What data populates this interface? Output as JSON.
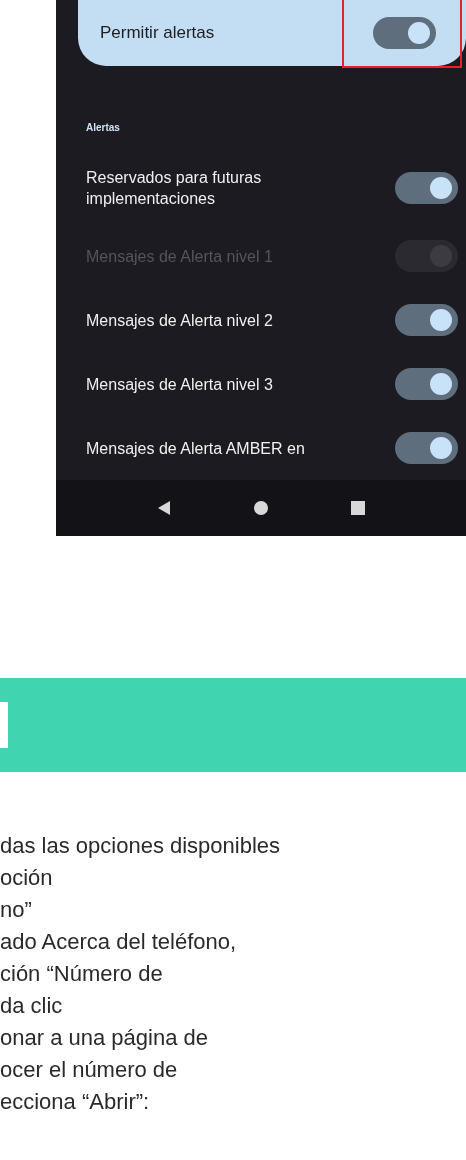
{
  "phone": {
    "master": {
      "label": "Permitir alertas",
      "on": true
    },
    "section_header": "Alertas",
    "rows": [
      {
        "label": "Reservados para futuras implementaciones",
        "on": true,
        "disabled": false
      },
      {
        "label": "Mensajes de Alerta nivel 1",
        "on": true,
        "disabled": true
      },
      {
        "label": "Mensajes de Alerta nivel 2",
        "on": true,
        "disabled": false
      },
      {
        "label": "Mensajes de Alerta nivel 3",
        "on": true,
        "disabled": false
      },
      {
        "label": "Mensajes de Alerta AMBER en",
        "on": true,
        "disabled": false
      }
    ]
  },
  "body_lines": [
    "das las opciones disponibles",
    "oción",
    "no”",
    "ado Acerca del teléfono,",
    "ción “Número de",
    "da clic",
    "onar a una página de",
    "ocer el número de",
    "ecciona “Abrir”:"
  ]
}
